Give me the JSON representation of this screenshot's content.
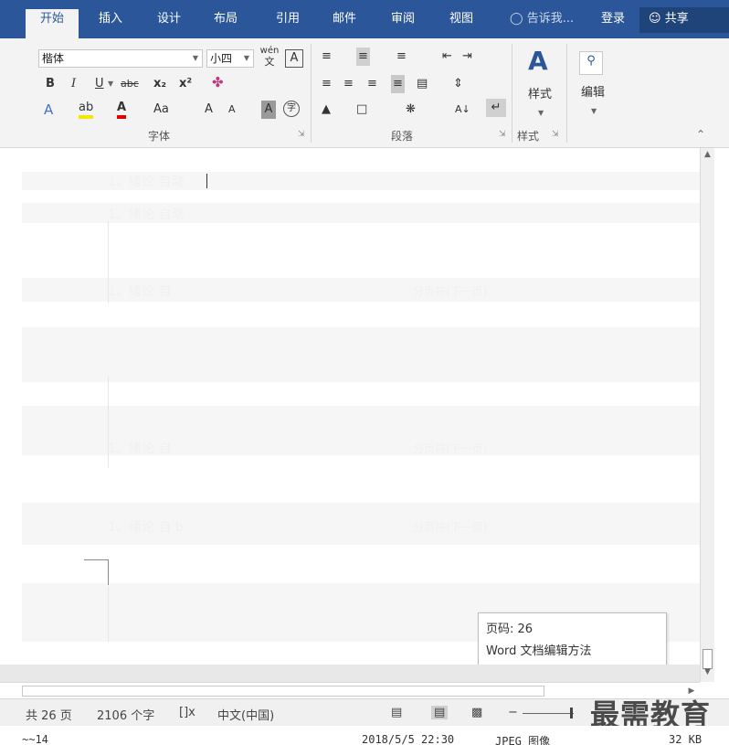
{
  "tabs": {
    "home": "开始",
    "insert": "插入",
    "design": "设计",
    "layout": "布局",
    "references": "引用",
    "mailings": "邮件",
    "review": "审阅",
    "view": "视图"
  },
  "tell_me": "告诉我...",
  "login": "登录",
  "share": "共享",
  "font": {
    "name": "楷体",
    "size": "小四",
    "pinyin": "wén",
    "pinyin_char": "文",
    "border_char": "A",
    "bold": "B",
    "italic": "I",
    "underline": "U",
    "strike": "abc",
    "subscript": "x₂",
    "superscript": "x²",
    "text_effect": "A",
    "highlight": "ab",
    "font_color": "A",
    "change_case": "Aa",
    "grow": "A",
    "shrink": "A",
    "shading": "A",
    "enclose": "字",
    "group_label": "字体"
  },
  "paragraph": {
    "group_label": "段落",
    "sort": "A↓",
    "marks": "↵"
  },
  "styles": {
    "label": "样式",
    "group_label": "样式"
  },
  "editing": {
    "label": "编辑"
  },
  "document": {
    "ghost_lines": [
      "1、绪论 自动",
      "1、绪论 自动",
      "1、绪论 自",
      "分页符(下一页)",
      "1、绪论 自",
      "分页符(下一页)",
      "1、绪论 自 b",
      "分页符(下一页)"
    ]
  },
  "tooltip": {
    "page": "页码: 26",
    "section": "Word 文档编辑方法"
  },
  "status": {
    "pages": "共 26 页",
    "words": "2106 个字",
    "proof_icon": "[]ⅹ",
    "language": "中文(中国)",
    "zoom_minus": "−",
    "watermark": "最需教育"
  },
  "file_strip": {
    "name": "~~14",
    "date": "2018/5/5 22:30",
    "type": "JPEG 图像",
    "size": "32 KB"
  }
}
